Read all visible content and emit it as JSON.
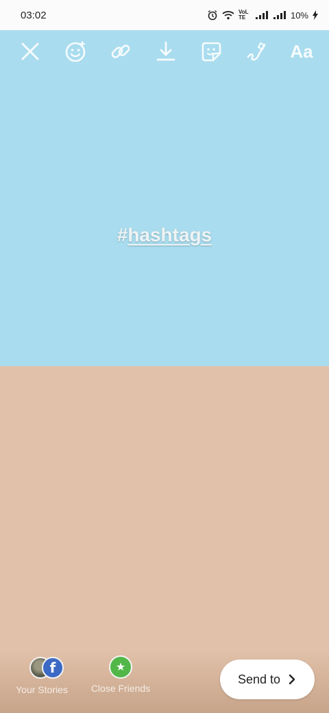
{
  "status_bar": {
    "time": "03:02",
    "battery": "10%",
    "network": "VoLTE"
  },
  "toolbar": {
    "close_icon": "close-icon",
    "effects_icon": "face-effects-icon",
    "link_icon": "link-icon",
    "download_icon": "download-icon",
    "sticker_icon": "sticker-icon",
    "draw_icon": "draw-icon",
    "text_label": "Aa"
  },
  "canvas": {
    "hashtag_symbol": "#",
    "hashtag_word": "hashtags",
    "top_color": "#a9dcee",
    "bottom_color": "#e1c1a9"
  },
  "share": {
    "your_stories_label": "Your Stories",
    "fb_badge": "f",
    "close_friends_label": "Close Friends",
    "close_friends_icon": "★",
    "send_label": "Send to"
  }
}
